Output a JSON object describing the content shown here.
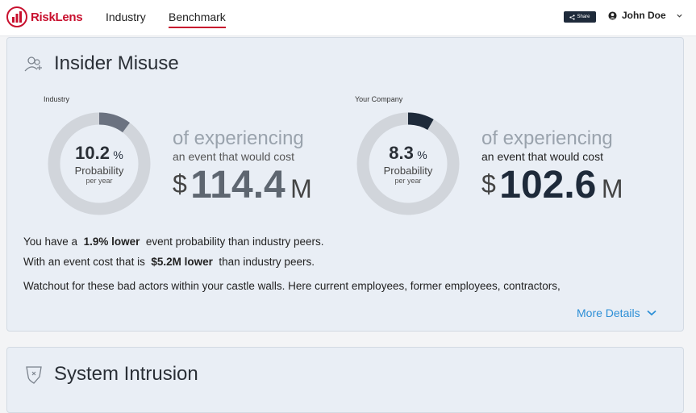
{
  "brand": {
    "name": "RiskLens",
    "accent": "#c8102e"
  },
  "nav": {
    "industry": "Industry",
    "benchmark": "Benchmark",
    "active": "Benchmark"
  },
  "header": {
    "share_label": "Share",
    "user_name": "John Doe"
  },
  "insider": {
    "title": "Insider Misuse",
    "industry": {
      "label": "Industry",
      "pct_value": "10.2",
      "pct_unit": "%",
      "probability_fraction": 0.102,
      "prob_label": "Probability",
      "per_year": "per year",
      "of_experiencing": "of experiencing",
      "would_cost": "an event that would cost",
      "currency": "$",
      "amount": "114.4",
      "unit": "M"
    },
    "company": {
      "label": "Your Company",
      "pct_value": "8.3",
      "pct_unit": "%",
      "probability_fraction": 0.083,
      "prob_label": "Probability",
      "per_year": "per year",
      "of_experiencing": "of experiencing",
      "would_cost": "an event that would cost",
      "currency": "$",
      "amount": "102.6",
      "unit": "M"
    },
    "summary1_pre": "You have a",
    "summary1_bold": "1.9% lower",
    "summary1_post": "event probability than industry peers.",
    "summary2_pre": "With an event cost that is",
    "summary2_bold": "$5.2M lower",
    "summary2_post": "than industry peers.",
    "summary3": "Watchout for these bad actors within your castle walls. Here current employees, former employees, contractors,",
    "more_details": "More Details"
  },
  "intrusion": {
    "title": "System Intrusion"
  },
  "colors": {
    "industry_arc": "#6b7280",
    "company_arc": "#1e2a3a",
    "ring_track": "#d1d5db",
    "link": "#2d8fd6"
  }
}
